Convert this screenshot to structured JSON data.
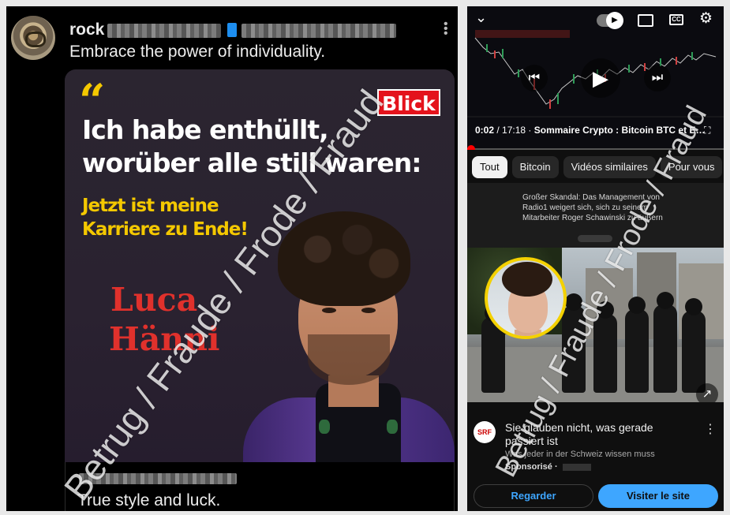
{
  "post": {
    "handle_prefix": "rock",
    "caption": "Embrace the power of individuality.",
    "footer_text": "True style and luck.",
    "image": {
      "brand": "Blick",
      "headline_line1": "Ich habe enthüllt,",
      "headline_line2": "worüber alle still waren:",
      "subline_line1": "Jetzt ist meine",
      "subline_line2": "Karriere zu Ende!",
      "name_first": "Luca",
      "name_last": "Hänni"
    }
  },
  "video": {
    "time_current": "0:02",
    "time_total": "/ 17:18",
    "title": "Sommaire Crypto : Bitcoin BTC et E…",
    "progress": 0.01,
    "colors": {
      "progress": "#ff0000",
      "accent_button": "#3ea6ff"
    }
  },
  "chips": [
    {
      "label": "Tout",
      "active": true
    },
    {
      "label": "Bitcoin",
      "active": false
    },
    {
      "label": "Vidéos similaires",
      "active": false
    },
    {
      "label": "Pour vous",
      "active": false
    }
  ],
  "article": {
    "text": "Großer Skandal: Das Management von Radio1 weigert sich, sich zu seinem Mitarbeiter Roger Schawinski zu äußern"
  },
  "ad": {
    "channel_logo": "SRF",
    "title": "Sie glauben nicht, was gerade passiert ist",
    "subtitle": "Was jeder in der Schweiz wissen muss",
    "sponsored": "Sponsorisé ·",
    "btn_watch": "Regarder",
    "btn_visit": "Visiter le site"
  },
  "watermark": {
    "left": "Betrug / Fraude / Frode / Fraud",
    "right": "Betrug / Fraude / Frode / Fraud"
  },
  "icons": [
    "chevron-down-icon",
    "autoplay-toggle-icon",
    "cast-icon",
    "captions-icon",
    "settings-gear-icon",
    "previous-icon",
    "play-icon",
    "next-icon",
    "fullscreen-icon",
    "more-vert-icon",
    "external-link-icon"
  ]
}
